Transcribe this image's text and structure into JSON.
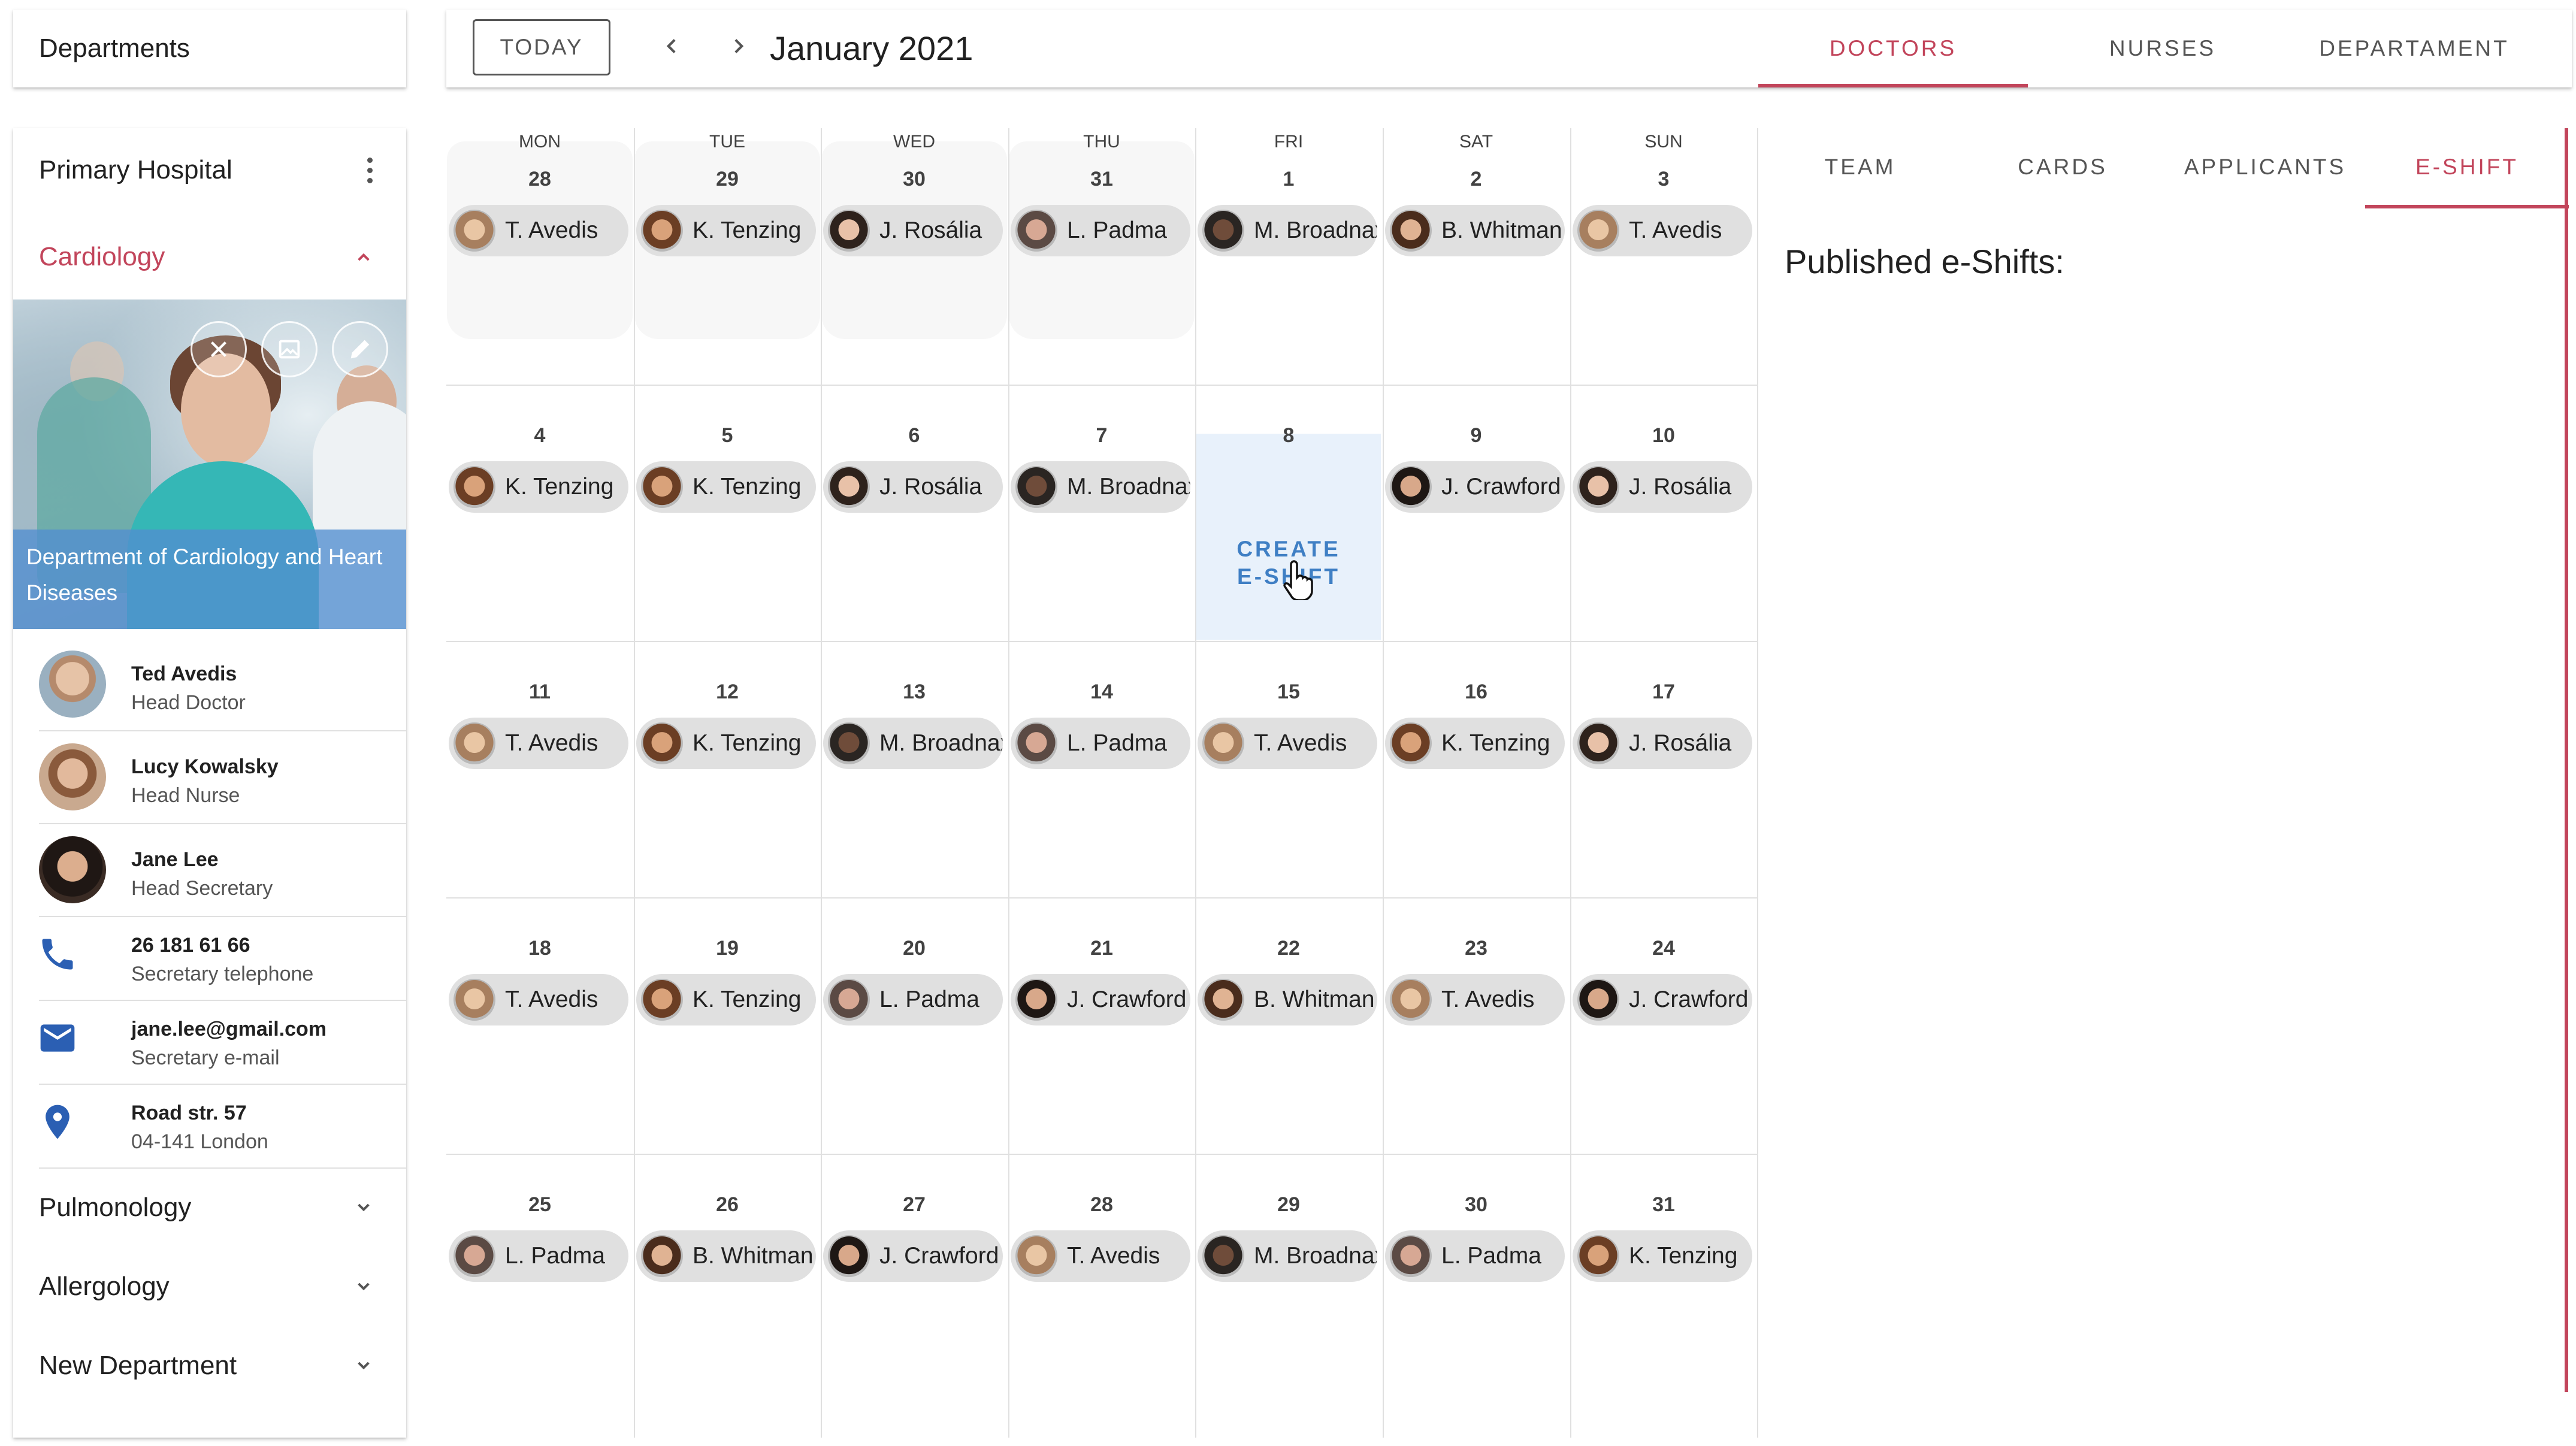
{
  "departments_header": {
    "title": "Departments"
  },
  "sidebar": {
    "hospital": "Primary Hospital",
    "department": "Cardiology",
    "image_caption": "Department of Cardiology and Heart Diseases",
    "contacts": [
      {
        "primary": "Ted Avedis",
        "secondary": "Head Doctor"
      },
      {
        "primary": "Lucy Kowalsky",
        "secondary": "Head Nurse"
      },
      {
        "primary": "Jane Lee",
        "secondary": "Head Secretary"
      },
      {
        "primary": "26 181 61 66",
        "secondary": "Secretary telephone"
      },
      {
        "primary": "jane.lee@gmail.com",
        "secondary": "Secretary e-mail"
      },
      {
        "primary": "Road str. 57",
        "secondary": "04-141 London"
      }
    ],
    "other_departments": [
      "Pulmonology",
      "Allergology",
      "New Department"
    ]
  },
  "toolbar": {
    "today_label": "TODAY",
    "month_title": "January 2021",
    "tabs": [
      "DOCTORS",
      "NURSES",
      "DEPARTAMENT"
    ],
    "active_tab": "DOCTORS"
  },
  "calendar": {
    "weekdays": [
      "MON",
      "TUE",
      "WED",
      "THU",
      "FRI",
      "SAT",
      "SUN"
    ],
    "create_label_line1": "CREATE",
    "create_label_line2": "E-SHIFT",
    "weeks": [
      [
        {
          "day": "28",
          "doctor": "T. Avedis"
        },
        {
          "day": "29",
          "doctor": "K. Tenzing"
        },
        {
          "day": "30",
          "doctor": "J. Rosália"
        },
        {
          "day": "31",
          "doctor": "L. Padma"
        },
        {
          "day": "1",
          "doctor": "M. Broadnax"
        },
        {
          "day": "2",
          "doctor": "B. Whitman"
        },
        {
          "day": "3",
          "doctor": "T. Avedis"
        }
      ],
      [
        {
          "day": "4",
          "doctor": "K. Tenzing"
        },
        {
          "day": "5",
          "doctor": "K. Tenzing"
        },
        {
          "day": "6",
          "doctor": "J. Rosália"
        },
        {
          "day": "7",
          "doctor": "M. Broadnax"
        },
        {
          "day": "8",
          "doctor": ""
        },
        {
          "day": "9",
          "doctor": "J. Crawford"
        },
        {
          "day": "10",
          "doctor": "J. Rosália"
        }
      ],
      [
        {
          "day": "11",
          "doctor": "T. Avedis"
        },
        {
          "day": "12",
          "doctor": "K. Tenzing"
        },
        {
          "day": "13",
          "doctor": "M. Broadnax"
        },
        {
          "day": "14",
          "doctor": "L. Padma"
        },
        {
          "day": "15",
          "doctor": "T. Avedis"
        },
        {
          "day": "16",
          "doctor": "K. Tenzing"
        },
        {
          "day": "17",
          "doctor": "J. Rosália"
        }
      ],
      [
        {
          "day": "18",
          "doctor": "T. Avedis"
        },
        {
          "day": "19",
          "doctor": "K. Tenzing"
        },
        {
          "day": "20",
          "doctor": "L. Padma"
        },
        {
          "day": "21",
          "doctor": "J. Crawford"
        },
        {
          "day": "22",
          "doctor": "B. Whitman"
        },
        {
          "day": "23",
          "doctor": "T. Avedis"
        },
        {
          "day": "24",
          "doctor": "J. Crawford"
        }
      ],
      [
        {
          "day": "25",
          "doctor": "L. Padma"
        },
        {
          "day": "26",
          "doctor": "B. Whitman"
        },
        {
          "day": "27",
          "doctor": "J. Crawford"
        },
        {
          "day": "28",
          "doctor": "T. Avedis"
        },
        {
          "day": "29",
          "doctor": "M. Broadnax"
        },
        {
          "day": "30",
          "doctor": "L. Padma"
        },
        {
          "day": "31",
          "doctor": "K. Tenzing"
        }
      ]
    ]
  },
  "right_panel": {
    "tabs": [
      "TEAM",
      "CARDS",
      "APPLICANTS",
      "E-SHIFT"
    ],
    "active_tab": "E-SHIFT",
    "title": "Published e-Shifts:"
  },
  "colors": {
    "accent": "#c2455b",
    "create_blue": "#3f7fc4",
    "icon_blue": "#2b5fb3",
    "chip_bg": "#e0e0e0"
  },
  "icons": {
    "sidebar_menu": "kebab-menu-icon",
    "expand": "chevron-down-icon",
    "collapse": "chevron-up-icon",
    "phone": "phone-icon",
    "email": "mail-icon",
    "location": "location-pin-icon",
    "image_actions": [
      "remove-image-icon",
      "change-image-icon",
      "edit-icon"
    ]
  }
}
